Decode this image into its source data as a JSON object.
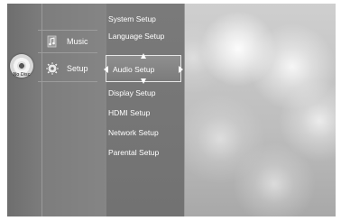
{
  "disc": {
    "label": "No Disc",
    "icon": "disc-icon"
  },
  "main_menu": {
    "items": [
      {
        "label": "Music",
        "icon": "music-note-icon"
      },
      {
        "label": "Setup",
        "icon": "gear-icon",
        "selected": true
      }
    ]
  },
  "setup_menu": {
    "items": [
      {
        "label": "System Setup"
      },
      {
        "label": "Language Setup"
      },
      {
        "label": "Audio Setup",
        "selected": true
      },
      {
        "label": "Display Setup"
      },
      {
        "label": "HDMI Setup"
      },
      {
        "label": "Network Setup"
      },
      {
        "label": "Parental Setup"
      }
    ]
  },
  "colors": {
    "frame": "#7a7a7a",
    "text": "#ffffff",
    "highlight_border": "#e6e6e6"
  }
}
